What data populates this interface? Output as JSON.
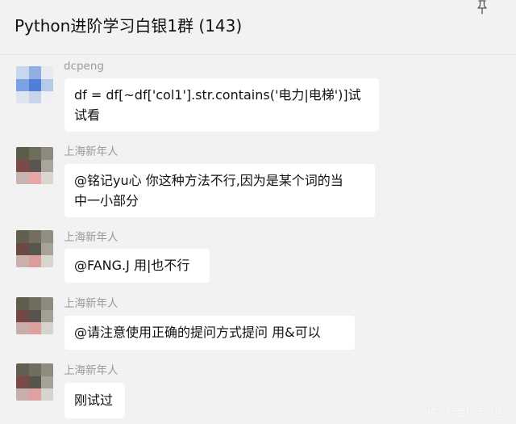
{
  "header": {
    "title": "Python进阶学习白银1群 (143)",
    "pin_icon": "pin-icon"
  },
  "messages": [
    {
      "sender": "dcpeng",
      "lines": [
        "df = df[~df['col1'].str.contains('电力|电梯')]试",
        "试看"
      ]
    },
    {
      "sender": "上海新年人",
      "lines": [
        "@铭记yu心 你这种方法不行,因为是某个词的当",
        "中一小部分"
      ]
    },
    {
      "sender": "上海新年人",
      "lines": [
        "@FANG.J 用|也不行"
      ]
    },
    {
      "sender": "上海新年人",
      "lines": [
        "@请注意使用正确的提问方式提问 用&可以"
      ]
    },
    {
      "sender": "上海新年人",
      "lines": [
        "刚试过"
      ]
    }
  ],
  "watermark": "@稀土掘金技术社区",
  "colors": {
    "background": "#f2f2f2",
    "bubble": "#ffffff",
    "sender_name": "#9a9a9a"
  }
}
